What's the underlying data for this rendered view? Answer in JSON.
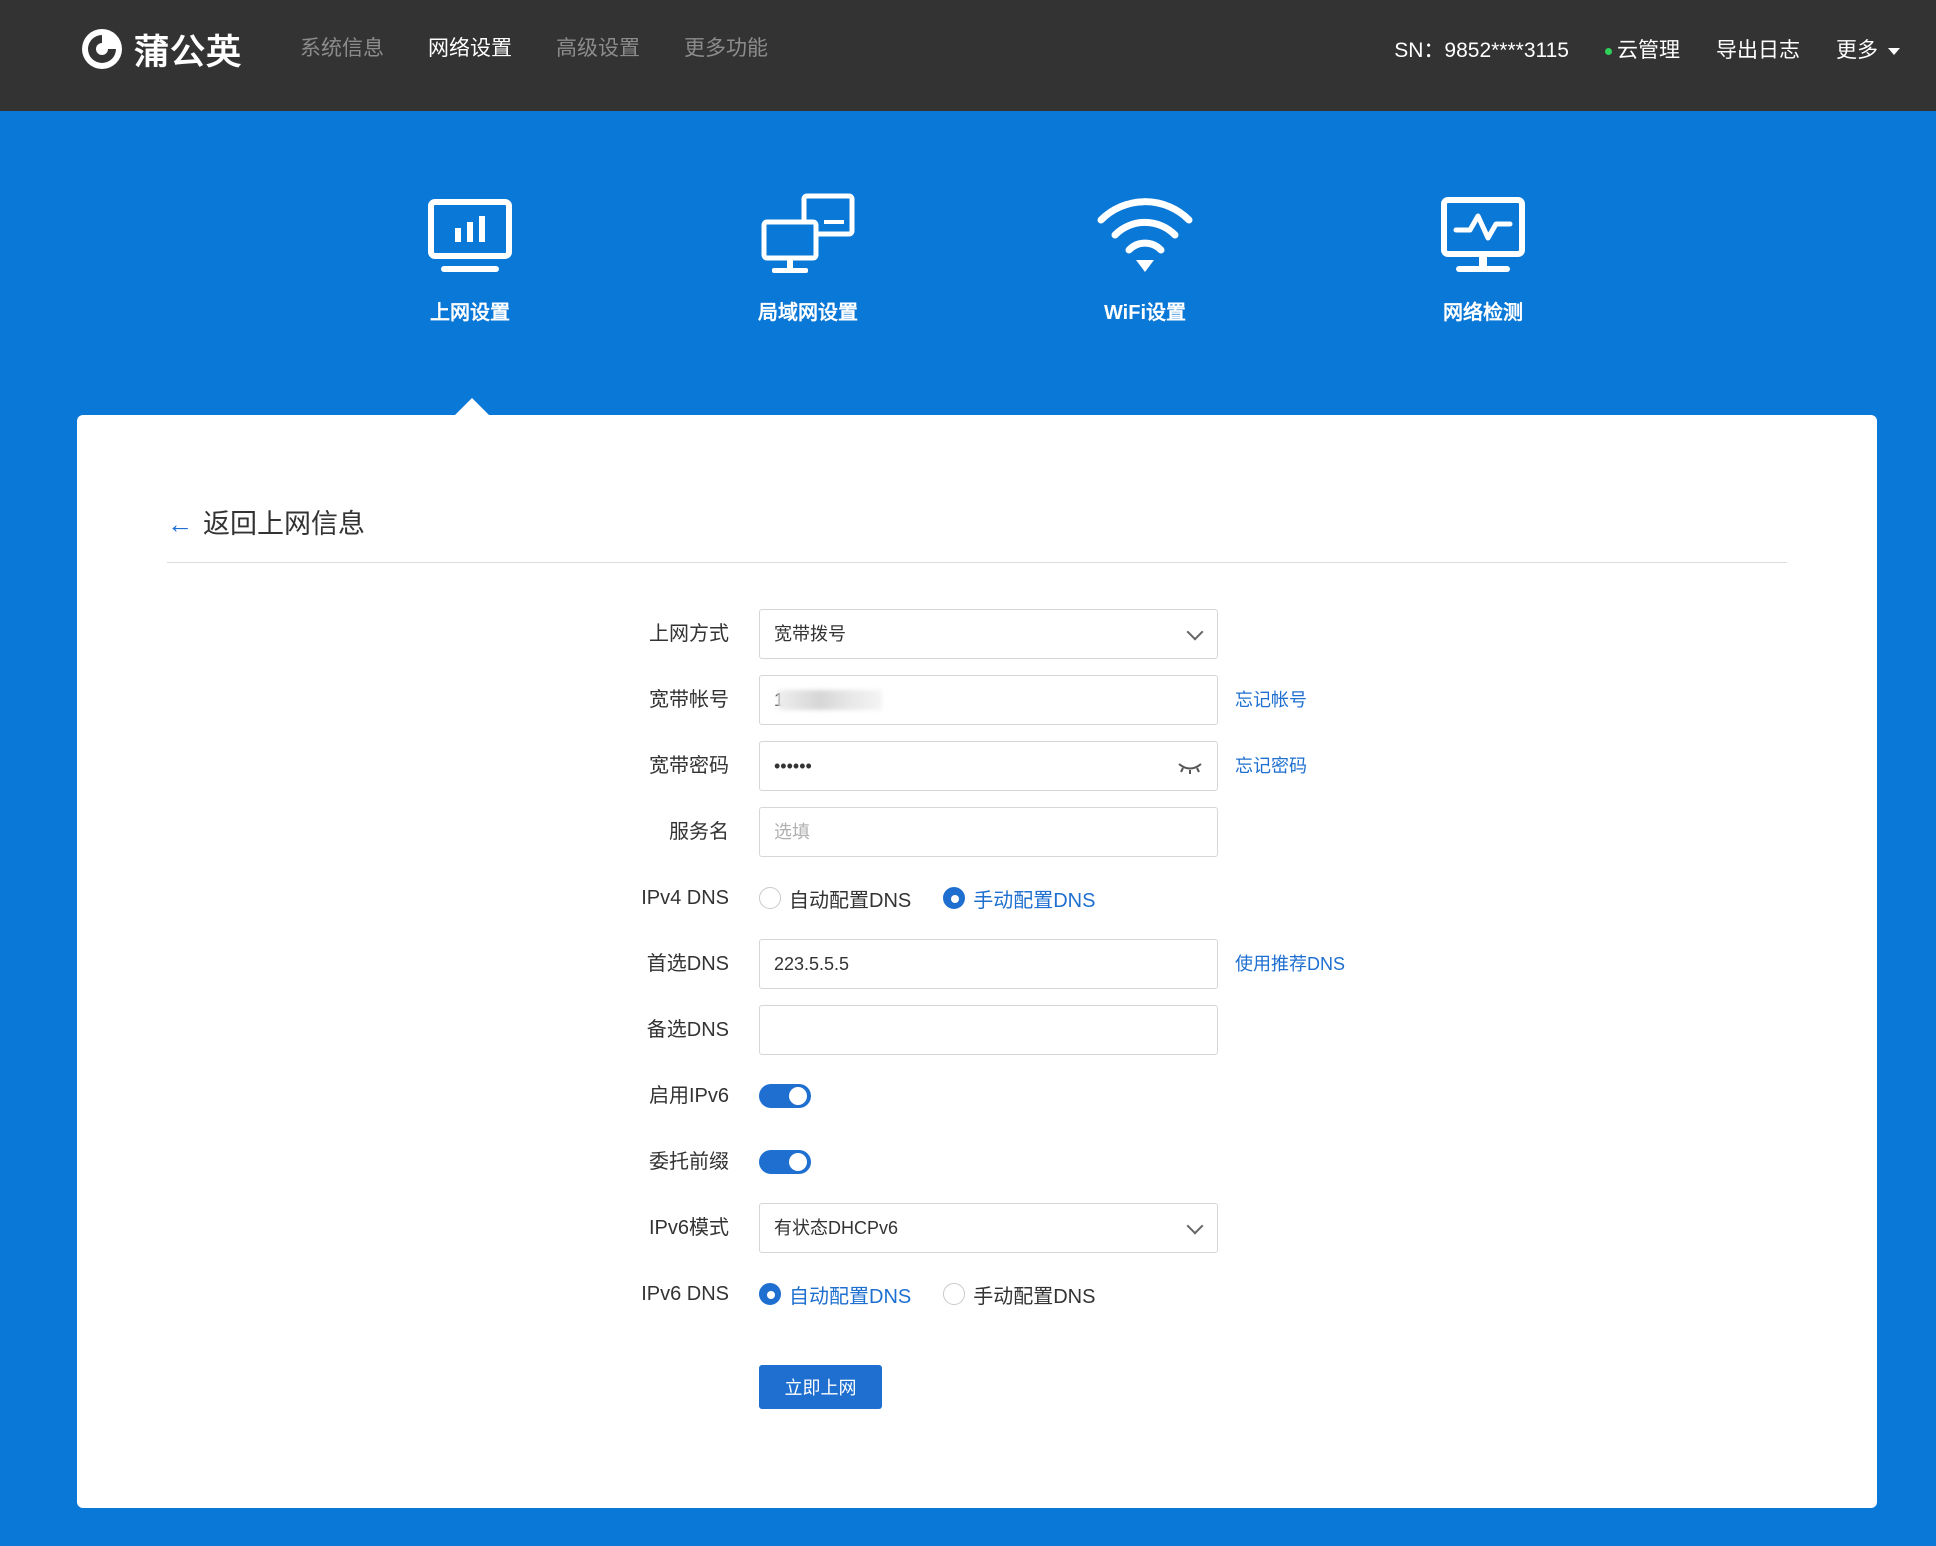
{
  "brand": {
    "name": "蒲公英"
  },
  "nav": {
    "items": [
      {
        "label": "系统信息",
        "active": false
      },
      {
        "label": "网络设置",
        "active": true
      },
      {
        "label": "高级设置",
        "active": false
      },
      {
        "label": "更多功能",
        "active": false
      }
    ]
  },
  "header": {
    "sn": "SN：9852****3115",
    "cloud": "云管理",
    "export_log": "导出日志",
    "more": "更多"
  },
  "tiles": [
    {
      "label": "上网设置",
      "icon": "monitor-chart-icon",
      "active": true
    },
    {
      "label": "局域网设置",
      "icon": "lan-devices-icon",
      "active": false
    },
    {
      "label": "WiFi设置",
      "icon": "wifi-icon",
      "active": false
    },
    {
      "label": "网络检测",
      "icon": "network-monitor-icon",
      "active": false
    }
  ],
  "back": {
    "label": "返回上网信息"
  },
  "form": {
    "connection_type": {
      "label": "上网方式",
      "value": "宽带拨号"
    },
    "account": {
      "label": "宽带帐号",
      "value": "1",
      "link": "忘记帐号"
    },
    "password": {
      "label": "宽带密码",
      "value": "••••••",
      "link": "忘记密码"
    },
    "service_name": {
      "label": "服务名",
      "placeholder": "选填"
    },
    "ipv4_dns": {
      "label": "IPv4 DNS",
      "options": [
        "自动配置DNS",
        "手动配置DNS"
      ],
      "selected": "手动配置DNS"
    },
    "primary_dns": {
      "label": "首选DNS",
      "value": "223.5.5.5",
      "link": "使用推荐DNS"
    },
    "secondary_dns": {
      "label": "备选DNS",
      "value": ""
    },
    "enable_ipv6": {
      "label": "启用IPv6",
      "on": true
    },
    "prefix_delegation": {
      "label": "委托前缀",
      "on": true
    },
    "ipv6_mode": {
      "label": "IPv6模式",
      "value": "有状态DHCPv6"
    },
    "ipv6_dns": {
      "label": "IPv6 DNS",
      "options": [
        "自动配置DNS",
        "手动配置DNS"
      ],
      "selected": "自动配置DNS"
    },
    "submit": "立即上网"
  },
  "colors": {
    "topbar": "#333333",
    "background": "#0a78d7",
    "accent": "#1e6fd0",
    "online": "#30d158"
  }
}
